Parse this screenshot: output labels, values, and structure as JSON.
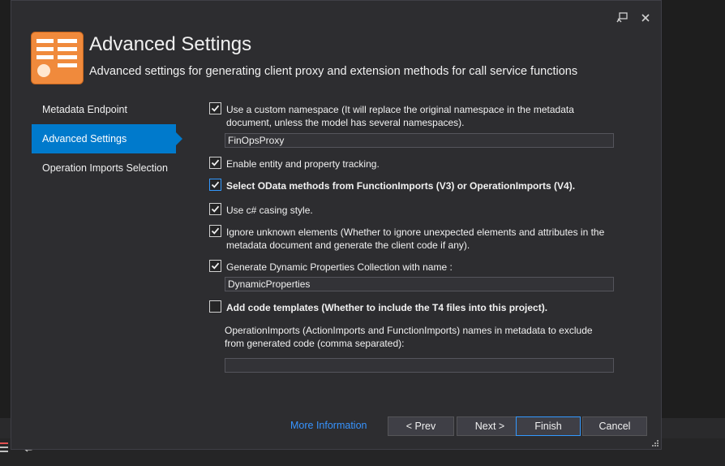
{
  "header": {
    "title": "Advanced Settings",
    "subtitle": "Advanced settings for generating client proxy and extension methods for call service functions"
  },
  "titlebar": {
    "pin_icon": "pin-icon",
    "close_icon": "close-icon"
  },
  "nav": {
    "items": [
      {
        "label": "Metadata Endpoint",
        "active": false
      },
      {
        "label": "Advanced Settings",
        "active": true
      },
      {
        "label": "Operation Imports Selection",
        "active": false
      }
    ]
  },
  "options": {
    "custom_namespace": {
      "checked": true,
      "label": "Use a custom namespace (It will replace the original namespace in the metadata document, unless the model has several namespaces).",
      "value": "FinOpsProxy"
    },
    "entity_tracking": {
      "checked": true,
      "label": "Enable entity and property tracking."
    },
    "select_odata_methods": {
      "checked": true,
      "label": "Select OData methods from FunctionImports (V3) or OperationImports (V4)."
    },
    "csharp_casing": {
      "checked": true,
      "label": "Use c# casing style."
    },
    "ignore_unknown": {
      "checked": true,
      "label": "Ignore unknown elements (Whether to ignore unexpected elements and attributes in the metadata document and generate the client code if any)."
    },
    "dynamic_properties": {
      "checked": true,
      "label": "Generate Dynamic Properties Collection with name :",
      "value": "DynamicProperties"
    },
    "add_code_templates": {
      "checked": false,
      "label": "Add code templates (Whether to include the T4 files into this project)."
    },
    "exclude_imports": {
      "label": "OperationImports (ActionImports and FunctionImports) names in metadata to exclude from generated code (comma separated):",
      "value": ""
    }
  },
  "footer": {
    "more_info": "More Information",
    "prev": "< Prev",
    "next": "Next >",
    "finish": "Finish",
    "cancel": "Cancel"
  },
  "colors": {
    "accent": "#007acc",
    "link": "#3794ff",
    "dialog_bg": "#2d2d30",
    "header_icon": "#f08a3c"
  }
}
